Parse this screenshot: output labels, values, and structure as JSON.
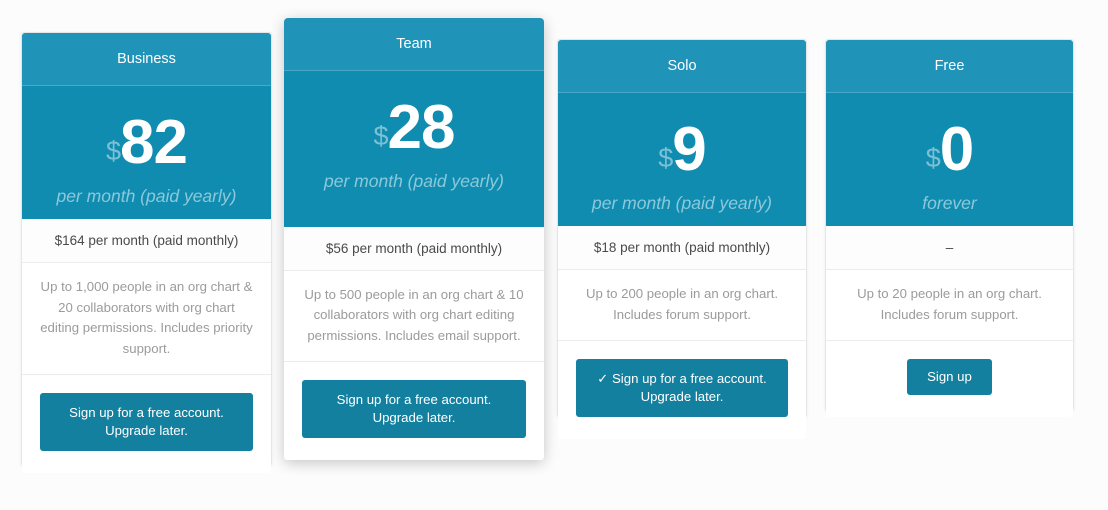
{
  "page": {
    "background_color": "#fcfcfc",
    "accent_color": "#0f8cb0",
    "header_color": "#2093b9",
    "button_color": "#13809f"
  },
  "plans": [
    {
      "name": "Business",
      "currency": "$",
      "amount": "82",
      "period": "per month (paid yearly)",
      "monthly": "$164 per month (paid monthly)",
      "description": "Up to 1,000 people in an org chart & 20 collaborators with org chart editing permissions. Includes priority support.",
      "cta_label": "Sign up for a free account. Upgrade later.",
      "cta_line1": "Sign up for a free account.",
      "cta_line2": "Upgrade later."
    },
    {
      "name": "Team",
      "currency": "$",
      "amount": "28",
      "period": "per month (paid yearly)",
      "monthly": "$56 per month (paid monthly)",
      "description": "Up to 500 people in an org chart & 10 collaborators with org chart editing permissions. Includes email support.",
      "cta_label": "Sign up for a free account. Upgrade later.",
      "cta_line1": "Sign up for a free account.",
      "cta_line2": "Upgrade later."
    },
    {
      "name": "Solo",
      "currency": "$",
      "amount": "9",
      "period": "per month (paid yearly)",
      "monthly": "$18 per month (paid monthly)",
      "description": "Up to 200 people in an org chart. Includes forum support.",
      "cta_label": "✓ Sign up for a free account. Upgrade later.",
      "cta_line1": "✓ Sign up for a free account.",
      "cta_line2": "Upgrade later."
    },
    {
      "name": "Free",
      "currency": "$",
      "amount": "0",
      "period": "forever",
      "monthly": "–",
      "description": "Up to 20 people in an org chart. Includes forum support.",
      "cta_label": "Sign up",
      "cta_line1": "Sign up",
      "cta_line2": ""
    }
  ]
}
